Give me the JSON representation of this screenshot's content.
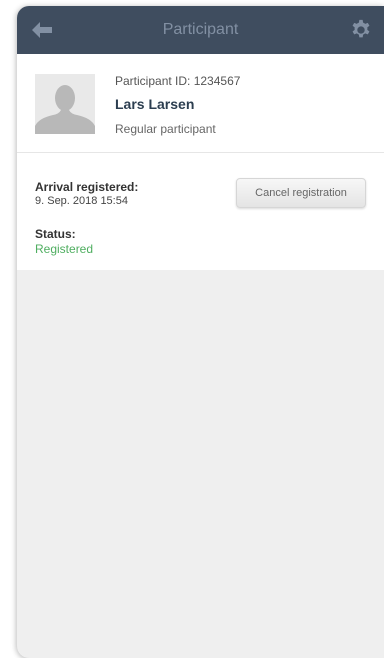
{
  "header": {
    "title": "Participant",
    "back_icon": "arrow-left-icon",
    "settings_icon": "gear-icon",
    "background_color": "#3f4d5f"
  },
  "participant": {
    "id_text": "Participant ID: 1234567",
    "name": "Lars Larsen",
    "type": "Regular participant",
    "avatar_icon": "person-silhouette-icon"
  },
  "arrival": {
    "label": "Arrival registered:",
    "value": "9. Sep. 2018 15:54"
  },
  "actions": {
    "cancel_label": "Cancel registration"
  },
  "status": {
    "label": "Status:",
    "value": "Registered",
    "color": "#4fae60"
  }
}
